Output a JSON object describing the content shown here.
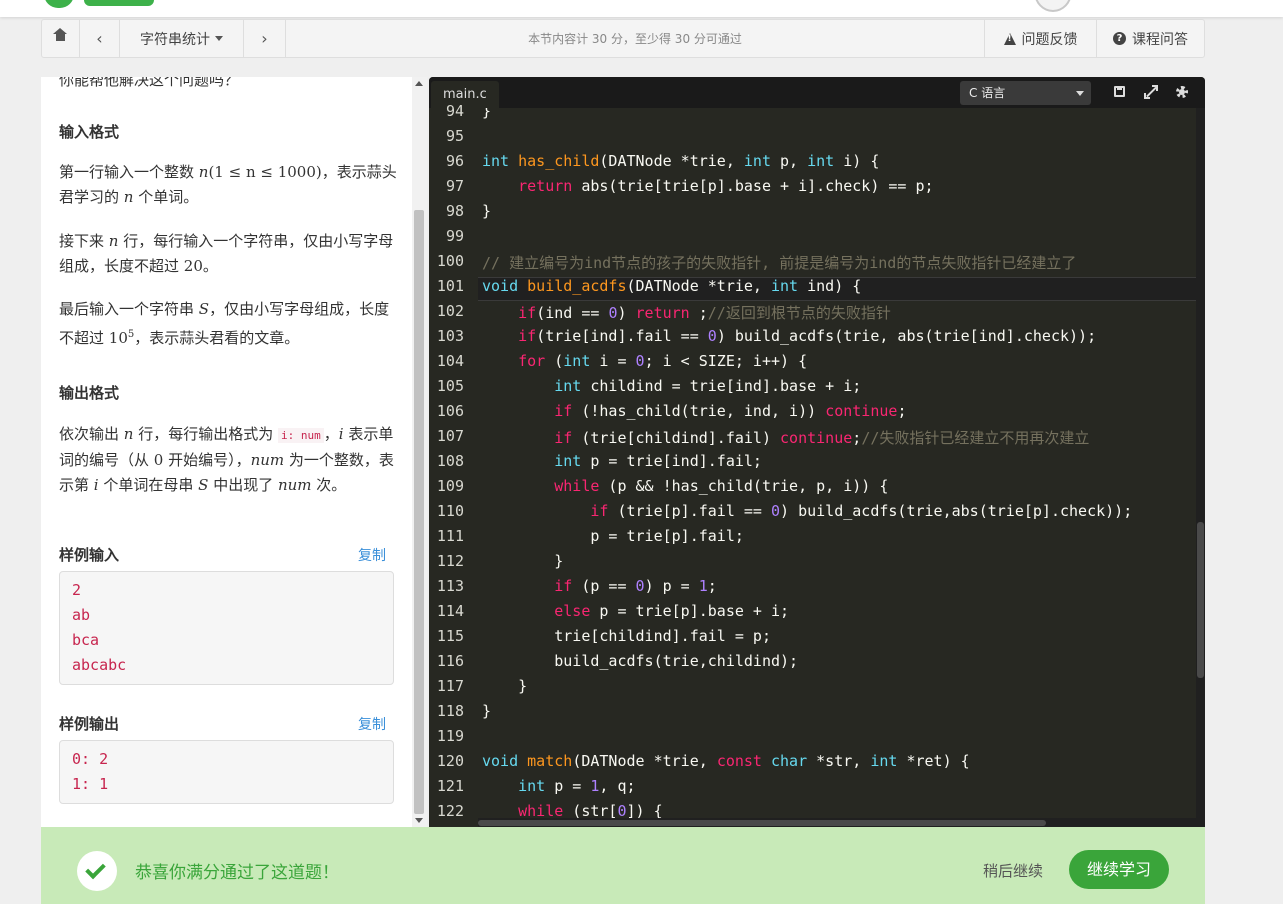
{
  "header": {
    "avatar_alt": ""
  },
  "nav": {
    "section_title": "字符串统计",
    "info": "本节内容计 30 分，至少得 30 分可通过",
    "feedback": "问题反馈",
    "course_qa": "课程问答"
  },
  "problem": {
    "cut_line": "你能帮他解决这个问题吗？",
    "input_heading": "输入格式",
    "input_p1_a": "第一行输入一个整数 ",
    "input_p1_math": "n",
    "input_p1_range": "(1 ≤ n ≤ 1000)",
    "input_p1_b": "，表示蒜头君学习的 ",
    "input_p1_math2": "n",
    "input_p1_c": " 个单词。",
    "input_p2_a": "接下来 ",
    "input_p2_math": "n",
    "input_p2_b": " 行，每行输入一个字符串，仅由小写字母组成，长度不超过 ",
    "input_p2_num": "20",
    "input_p2_c": "。",
    "input_p3_a": "最后输入一个字符串 ",
    "input_p3_math": "S",
    "input_p3_b": "，仅由小写字母组成，长度不超过 ",
    "input_p3_num": "10",
    "input_p3_exp": "5",
    "input_p3_c": "，表示蒜头君看的文章。",
    "output_heading": "输出格式",
    "output_p_a": "依次输出 ",
    "output_p_math": "n",
    "output_p_b": " 行，每行输出格式为 ",
    "output_p_code": "i: num",
    "output_p_c": "，",
    "output_p_math2": "i",
    "output_p_d": " 表示单词的编号（从 ",
    "output_p_num": "0",
    "output_p_e": " 开始编号），",
    "output_p_math3": "num",
    "output_p_f": " 为一个整数，表示第 ",
    "output_p_math4": "i",
    "output_p_g": " 个单词在母串 ",
    "output_p_math5": "S",
    "output_p_h": " 中出现了 ",
    "output_p_math6": "num",
    "output_p_i": " 次。",
    "sample_input_heading": "样例输入",
    "sample_output_heading": "样例输出",
    "copy_label": "复制",
    "sample_input": [
      "2",
      "ab",
      "bca",
      "abcabc"
    ],
    "sample_output": [
      "0: 2",
      "1: 1"
    ]
  },
  "editor": {
    "tab": "main.c",
    "language": "C 语言",
    "line_numbers": [
      "94",
      "95",
      "96",
      "97",
      "98",
      "99",
      "100",
      "101",
      "102",
      "103",
      "104",
      "105",
      "106",
      "107",
      "108",
      "109",
      "110",
      "111",
      "112",
      "113",
      "114",
      "115",
      "116",
      "117",
      "118",
      "119",
      "120",
      "121",
      "122"
    ]
  },
  "banner": {
    "message": "恭喜你满分通过了这道题！",
    "later": "稍后继续",
    "continue": "继续学习"
  },
  "colors": {
    "accent_green": "#3aa53a",
    "banner_bg": "#c8eab8",
    "editor_bg": "#272822",
    "link_blue": "#3a8fd9",
    "sample_red": "#c7254e"
  }
}
